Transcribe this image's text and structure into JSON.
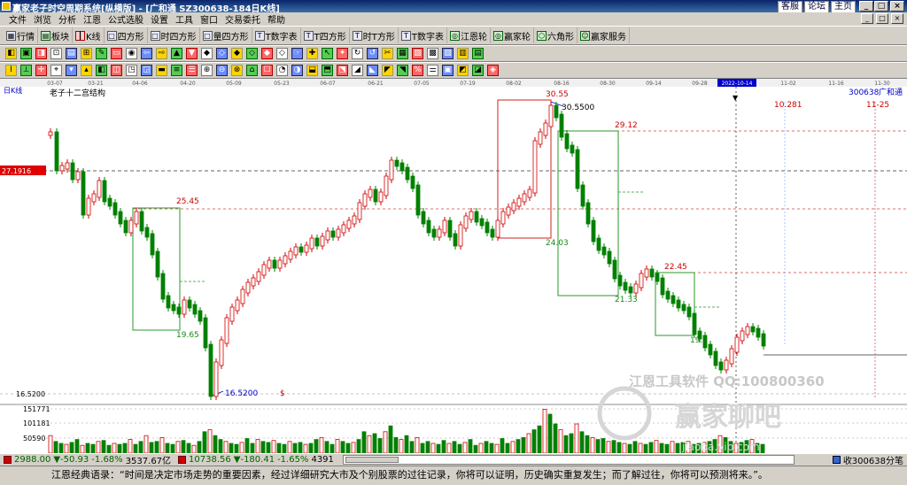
{
  "window": {
    "title": "赢家老子时空周期系统[纵横版] - [广和通    SZ300638-184日K线]",
    "links": [
      "客服",
      "论坛",
      "主页"
    ],
    "buttons": [
      "_",
      "□",
      "×"
    ]
  },
  "menu": {
    "items": [
      "文件",
      "浏览",
      "分析",
      "江恩",
      "公式选股",
      "设置",
      "工具",
      "窗口",
      "交易委托",
      "帮助"
    ],
    "mdi_buttons": [
      "_",
      "□",
      "×"
    ]
  },
  "toolbar1": {
    "items": [
      {
        "label": "行情",
        "icon": "grid-icon"
      },
      {
        "label": "板块",
        "icon": "blocks-icon"
      },
      {
        "label": "K线",
        "icon": "candlestick-icon"
      },
      {
        "label": "四方形",
        "icon": "square-icon"
      },
      {
        "label": "时四方形",
        "icon": "time-square-icon"
      },
      {
        "label": "量四方形",
        "icon": "volume-square-icon"
      },
      {
        "label": "T数字表",
        "icon": "table-icon"
      },
      {
        "label": "T四方形",
        "icon": "t-square-icon"
      },
      {
        "label": "时T方形",
        "icon": "time-t-square-icon"
      },
      {
        "label": "T数字表",
        "icon": "table-icon"
      },
      {
        "label": "江恩轮",
        "icon": "wheel-icon"
      },
      {
        "label": "赢家轮",
        "icon": "wheel-icon"
      },
      {
        "label": "六角形",
        "icon": "hexagon-icon"
      },
      {
        "label": "赢家服务",
        "icon": "service-icon"
      }
    ]
  },
  "toolbar2": {
    "glyphs": [
      "◧",
      "▣",
      "◨",
      "⊡",
      "▤",
      "⊞",
      "✎",
      "▭",
      "◉",
      "⇦",
      "⇨",
      "▲",
      "▼",
      "◆",
      "◇",
      "◆",
      "◇",
      "◆",
      "◇",
      "☞",
      "✚",
      "↖",
      "✦",
      "↻",
      "↺",
      "✂",
      "▦",
      "▨",
      "▩",
      "▧",
      "▥",
      "▤"
    ]
  },
  "toolbar3": {
    "glyphs": [
      "Ⅰ",
      "⟂",
      "✛",
      "⌖",
      "▾",
      "▴",
      "◧",
      "◫",
      "◳",
      "◲",
      "▬",
      "≡",
      "☰",
      "⊕",
      "⊖",
      "⊗",
      "⌂",
      "☐",
      "◔",
      "◑",
      "⬓",
      "⬒",
      "⬔",
      "◢",
      "◣",
      "◤",
      "◥",
      "%",
      "⚌",
      "▣",
      "◩",
      "◪",
      "◈"
    ]
  },
  "chart": {
    "period_label": "日K线",
    "study_name": "老子十二宫结构",
    "symbol_code": "300638",
    "symbol_name": "广和通",
    "right_top_price": "10.281",
    "right_top_date": "11-25",
    "highlight_date": "2022-10-14",
    "left_price_tag": "27.1916",
    "low_price_label": "16.5200",
    "low_marker": "16.5200",
    "dollar_marker": "$",
    "dates": [
      "03-07",
      "03-21",
      "04-06",
      "04-20",
      "05-09",
      "05-23",
      "06-07",
      "06-21",
      "07-05",
      "07-19",
      "08-02",
      "08-16",
      "08-30",
      "09-14",
      "09-28",
      "2022-10-14",
      "11-02",
      "11-16",
      "11-30"
    ],
    "box_labels": [
      "25.45",
      "19.65",
      "30.55",
      "30.5500",
      "29.12",
      "24.03",
      "21.33",
      "22.45",
      "19.1"
    ],
    "volume_labels": [
      "151771",
      "101181",
      "50590"
    ],
    "watermark_text1": "江恩工具软件  QQ:100800360",
    "watermark_logo_text": "赢家聊吧",
    "watermark_url": "jiaoba.vip.com"
  },
  "status": {
    "index1_value": "2988.00",
    "index1_change": "▼-50.93",
    "index1_pct": "-1.68%",
    "index1_amount": "3537.67亿",
    "index2_value": "10738.56",
    "index2_change": "▼-180.41",
    "index2_pct": "-1.65%",
    "index2_amount": "4391",
    "right_text": "收300638分笔"
  },
  "quote": {
    "text": "江恩经典语录：“时间是决定市场走势的重要因素，经过详细研究大市及个别股票的过往记录，你将可以证明，历史确实重复发生；而了解过往，你将可以预测将来。”。"
  }
}
